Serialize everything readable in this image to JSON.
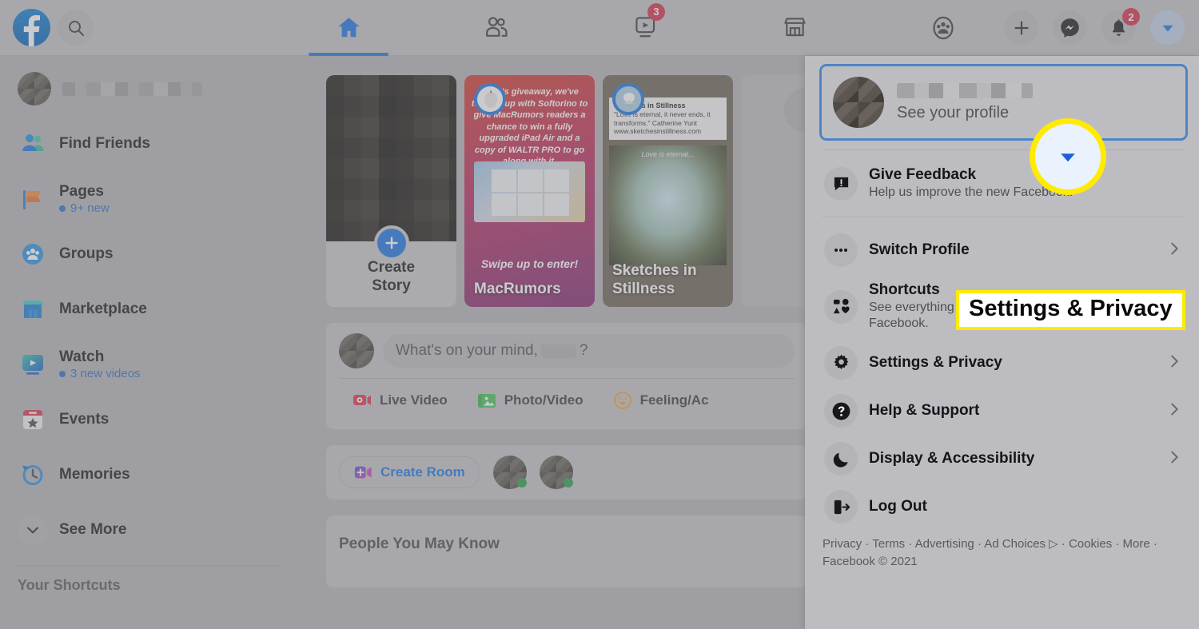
{
  "header": {
    "logo": "facebook-logo",
    "search_placeholder": "Search Facebook",
    "nav": [
      {
        "name": "home",
        "icon": "home-icon",
        "active": true,
        "badge": ""
      },
      {
        "name": "friends",
        "icon": "friends-icon",
        "active": false,
        "badge": ""
      },
      {
        "name": "watch",
        "icon": "watch-icon",
        "active": false,
        "badge": "3"
      },
      {
        "name": "marketplace",
        "icon": "marketplace-icon",
        "active": false,
        "badge": ""
      },
      {
        "name": "groups",
        "icon": "groups-icon",
        "active": false,
        "badge": ""
      }
    ],
    "actions": [
      {
        "name": "create",
        "icon": "plus-icon",
        "badge": ""
      },
      {
        "name": "messenger",
        "icon": "messenger-icon",
        "badge": ""
      },
      {
        "name": "notifications",
        "icon": "bell-icon",
        "badge": "2"
      },
      {
        "name": "account",
        "icon": "chevron-down-icon",
        "badge": ""
      }
    ]
  },
  "sidebar": {
    "profile_name": "",
    "items": [
      {
        "label": "Find Friends",
        "sub": "",
        "icon": "find-friends-icon"
      },
      {
        "label": "Pages",
        "sub": "9+ new",
        "icon": "pages-icon"
      },
      {
        "label": "Groups",
        "sub": "",
        "icon": "groups-icon"
      },
      {
        "label": "Marketplace",
        "sub": "",
        "icon": "marketplace-icon"
      },
      {
        "label": "Watch",
        "sub": "3 new videos",
        "icon": "watch-icon"
      },
      {
        "label": "Events",
        "sub": "",
        "icon": "events-icon"
      },
      {
        "label": "Memories",
        "sub": "",
        "icon": "memories-icon"
      },
      {
        "label": "See More",
        "sub": "",
        "icon": "chevron-down-icon"
      }
    ],
    "shortcuts_heading": "Your Shortcuts"
  },
  "feed": {
    "stories": [
      {
        "type": "create",
        "line1": "Create",
        "line2": "Story"
      },
      {
        "type": "macrumors",
        "title": "MacRumors",
        "body": "week's giveaway, we've teamed up with Softorino to give MacRumors readers a chance to win a fully upgraded iPad Air and a copy of WALTR PRO to go along with it.",
        "swipe": "Swipe up to enter!"
      },
      {
        "type": "sketches",
        "title": "Sketches in Stillness",
        "card_name": "Sketches in Stillness",
        "quote": "\"Love is eternal, it never ends, it transforms.\" Catherine Yunt www.sketchesinstillness.com",
        "art_caption": "Love is eternal..."
      },
      {
        "type": "placeholder"
      }
    ],
    "composer": {
      "placeholder_prefix": "What's on your mind,",
      "placeholder_suffix": "?",
      "actions": [
        {
          "label": "Live Video",
          "icon": "live-video-icon"
        },
        {
          "label": "Photo/Video",
          "icon": "photo-video-icon"
        },
        {
          "label": "Feeling/Ac",
          "icon": "feeling-icon"
        }
      ]
    },
    "room": {
      "button_label": "Create Room",
      "icon": "video-plus-icon"
    },
    "people_you_may_know": "People You May Know"
  },
  "dropdown": {
    "profile": {
      "name": "",
      "subtitle": "See your profile"
    },
    "feedback": {
      "title": "Give Feedback",
      "subtitle": "Help us improve the new Facebook.",
      "icon": "feedback-icon"
    },
    "items": [
      {
        "title": "Switch Profile",
        "subtitle": "",
        "icon": "dots-icon",
        "chevron": true
      },
      {
        "title": "Shortcuts",
        "subtitle": "See everything you can do on Facebook.",
        "icon": "shortcuts-icon",
        "chevron": false
      },
      {
        "title": "Settings & Privacy",
        "subtitle": "",
        "icon": "gear-icon",
        "chevron": true
      },
      {
        "title": "Help & Support",
        "subtitle": "",
        "icon": "question-icon",
        "chevron": true
      },
      {
        "title": "Display & Accessibility",
        "subtitle": "",
        "icon": "moon-icon",
        "chevron": true
      },
      {
        "title": "Log Out",
        "subtitle": "",
        "icon": "logout-icon",
        "chevron": false
      }
    ],
    "footer": "Privacy · Terms · Advertising · Ad Choices ▷ · Cookies · More · Facebook © 2021"
  },
  "annotations": {
    "callout_label": "Settings & Privacy",
    "highlight_color": "#ffeb00",
    "circle_icon": "chevron-down-icon"
  }
}
